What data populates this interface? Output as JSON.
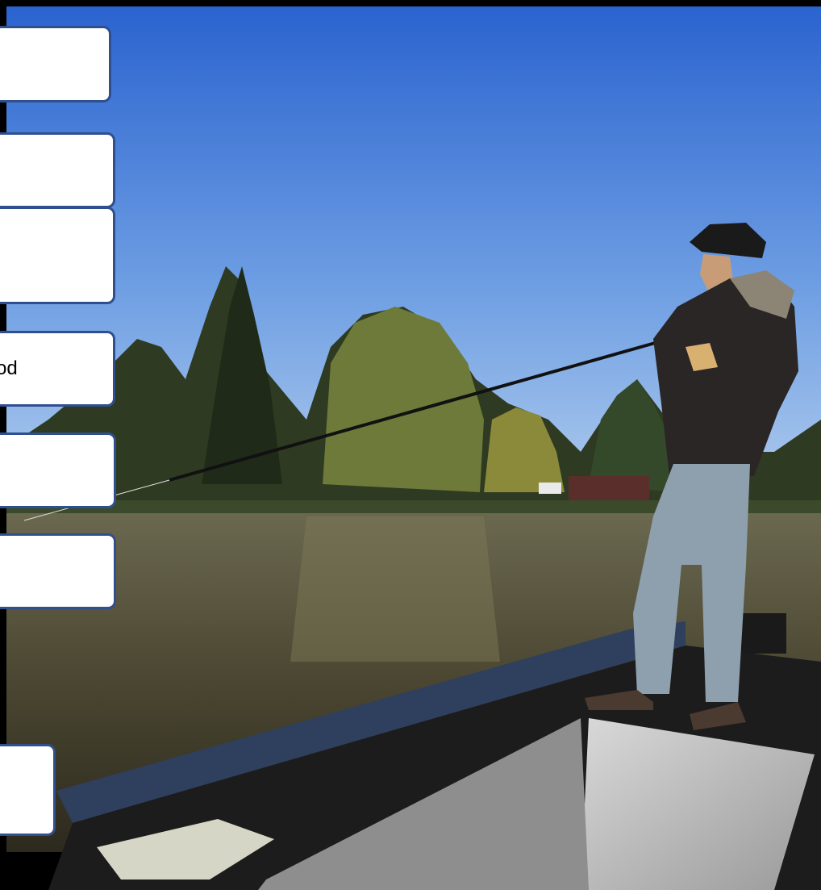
{
  "image": {
    "description_free": true,
    "colors": {
      "sky_top": "#2f6bd6",
      "sky_bottom": "#a9c8ee",
      "water": "#4e4a34",
      "boat_deck": "#1c1c1c",
      "label_border": "#2f4f8f",
      "label_fill": "#ffffff"
    }
  },
  "labels": [
    {
      "text": ""
    },
    {
      "text": ""
    },
    {
      "text": ""
    },
    {
      "text": "od"
    },
    {
      "text": ""
    },
    {
      "text": ""
    },
    {
      "text": ""
    }
  ]
}
